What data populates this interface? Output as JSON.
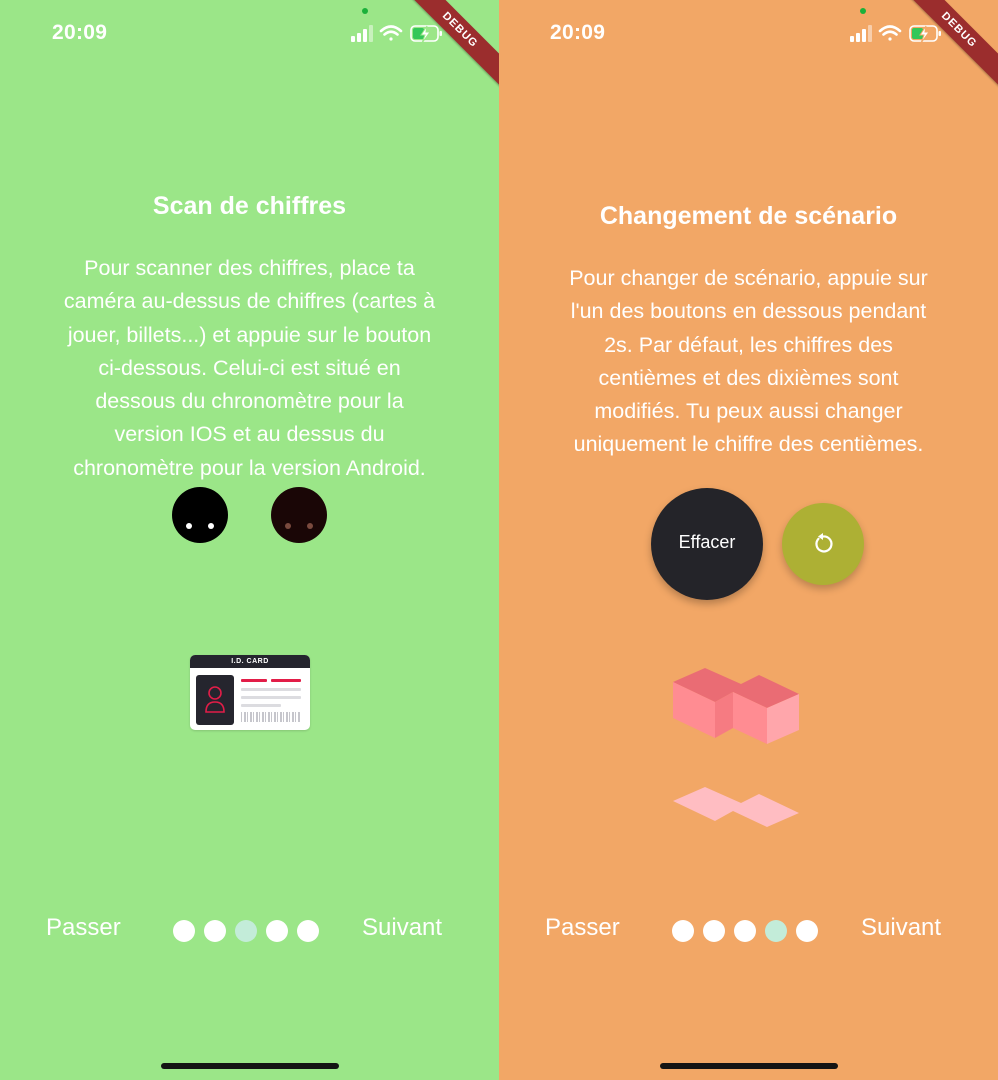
{
  "status": {
    "time": "20:09",
    "debug_label": "DEBUG"
  },
  "pages": [
    {
      "title": "Scan de chiffres",
      "lines": [
        "Pour scanner des chiffres, place ta",
        "caméra au-dessus de chiffres (cartes à",
        "jouer, billets...) et appuie sur le bouton",
        "ci-dessous. Celui-ci est situé en",
        "dessous du chronomètre pour la",
        "version IOS et au dessus du",
        "chronomètre pour la version Android."
      ],
      "card_label": "I.D. CARD",
      "skip_label": "Passer",
      "next_label": "Suivant",
      "active_dot": 2,
      "dot_count": 5
    },
    {
      "title": "Changement de scénario",
      "lines": [
        "Pour changer de scénario, appuie sur",
        "l'un des boutons en dessous pendant",
        "2s. Par défaut, les chiffres des",
        "centièmes et des dixièmes sont",
        "modifiés. Tu peux aussi changer",
        "uniquement le chiffre des centièmes."
      ],
      "clear_button_label": "Effacer",
      "skip_label": "Passer",
      "next_label": "Suivant",
      "active_dot": 3,
      "dot_count": 5
    }
  ],
  "colors": {
    "left_bg": "#9be688",
    "right_bg": "#f2a766",
    "active_dot": "#c3ecd9",
    "clear_button": "#242429",
    "reset_button": "#adb034",
    "shape_pink": "#ff8a8f",
    "shape_light": "#ffbdc2"
  },
  "icons": [
    "signal-icon",
    "wifi-icon",
    "battery-charging-icon",
    "reset-icon",
    "id-card-icon",
    "avatar-icon"
  ]
}
